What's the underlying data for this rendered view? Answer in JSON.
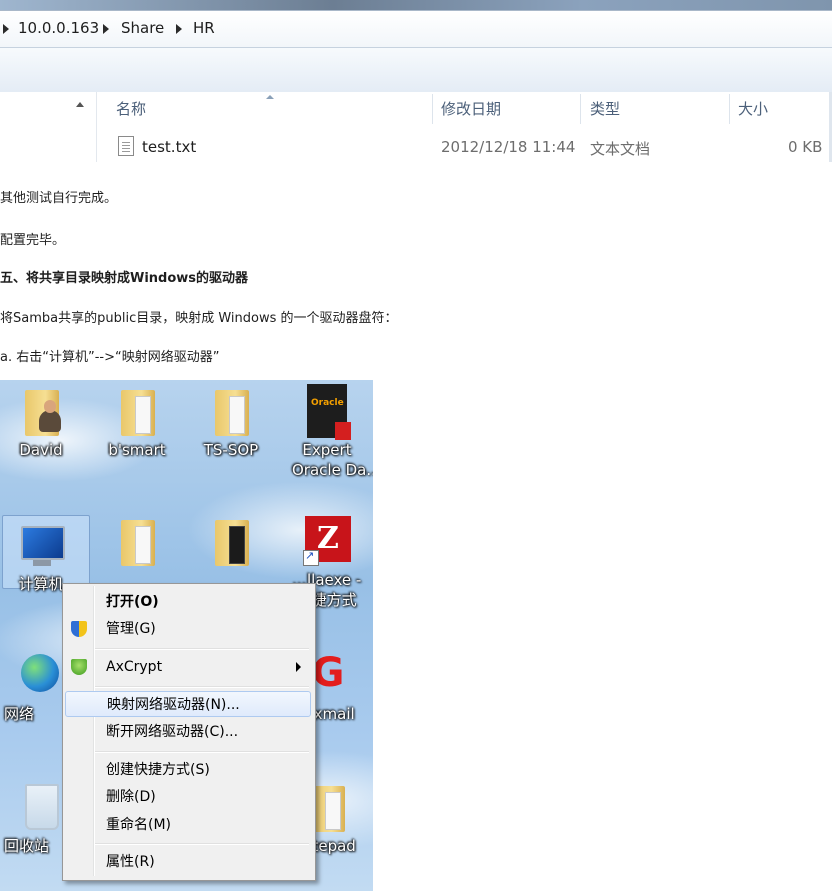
{
  "explorer": {
    "breadcrumb": [
      "10.0.0.163",
      "Share",
      "HR"
    ],
    "columns": [
      "名称",
      "修改日期",
      "类型",
      "大小"
    ],
    "files": [
      {
        "name": "test.txt",
        "modified": "2012/12/18 11:44",
        "type": "文本文档",
        "size": "0 KB"
      }
    ]
  },
  "article": {
    "p1": "其他测试自行完成。",
    "p2": "配置完毕。",
    "heading": "五、将共享目录映射成Windows的驱动器",
    "p3": "将Samba共享的public目录，映射成 Windows 的一个驱动器盘符：",
    "p4": "a. 右击“计算机”-->“映射网络驱动器”"
  },
  "desktop": {
    "icons": {
      "david": "David",
      "bsmart": "b'smart",
      "tssop": "TS-SOP",
      "expert1": "Expert",
      "expert2": "Oracle Da...",
      "computer": "计算机",
      "filezilla1": "...llaexe -",
      "filezilla2": "...捷方式",
      "network": "网络",
      "foxmail": "...xmail",
      "recycle": "回收站",
      "notepad": "...tepad"
    },
    "book_text": "Oracle"
  },
  "context_menu": {
    "items": [
      {
        "label": "打开(O)",
        "bold": true
      },
      {
        "label": "管理(G)"
      },
      {
        "label": "AxCrypt",
        "submenu": true
      },
      {
        "label": "映射网络驱动器(N)...",
        "highlighted": true
      },
      {
        "label": "断开网络驱动器(C)..."
      },
      {
        "label": "创建快捷方式(S)"
      },
      {
        "label": "删除(D)"
      },
      {
        "label": "重命名(M)"
      },
      {
        "label": "属性(R)"
      }
    ]
  },
  "colors": {
    "menu_bg": "#f0f0f0",
    "highlight_border": "#aecaf0",
    "column_header": "#4c607a"
  }
}
